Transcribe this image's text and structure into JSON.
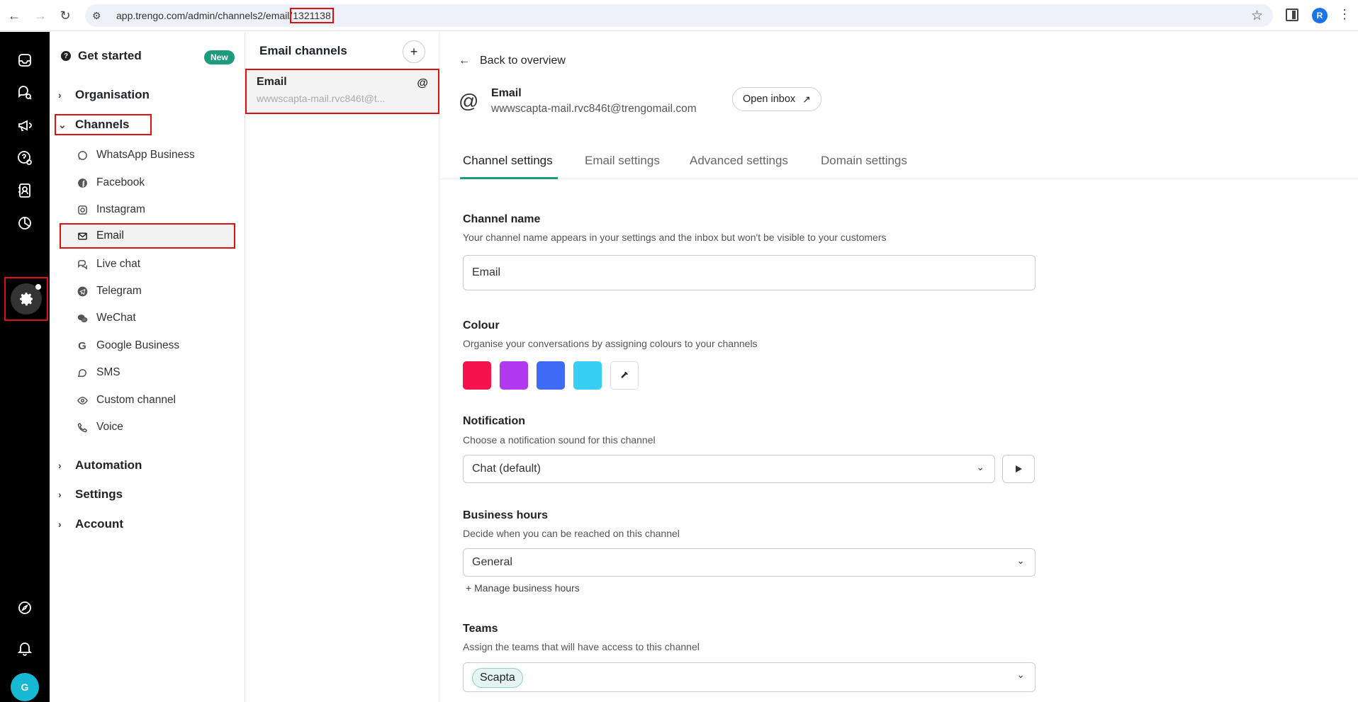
{
  "browser": {
    "url_prefix": "app.trengo.com/admin/channels2/email/",
    "url_id": "1321138",
    "profile_initial": "R"
  },
  "rail": {
    "avatar_initial": "G"
  },
  "nav": {
    "get_started": "Get started",
    "new_badge": "New",
    "sections": {
      "organisation": "Organisation",
      "channels": "Channels",
      "automation": "Automation",
      "settings": "Settings",
      "account": "Account"
    },
    "channels": [
      {
        "label": "WhatsApp Business",
        "icon": "whatsapp-icon"
      },
      {
        "label": "Facebook",
        "icon": "facebook-icon"
      },
      {
        "label": "Instagram",
        "icon": "instagram-icon"
      },
      {
        "label": "Email",
        "icon": "mail-icon"
      },
      {
        "label": "Live chat",
        "icon": "chat-icon"
      },
      {
        "label": "Telegram",
        "icon": "telegram-icon"
      },
      {
        "label": "WeChat",
        "icon": "wechat-icon"
      },
      {
        "label": "Google Business",
        "icon": "google-icon"
      },
      {
        "label": "SMS",
        "icon": "sms-icon"
      },
      {
        "label": "Custom channel",
        "icon": "eye-icon"
      },
      {
        "label": "Voice",
        "icon": "phone-icon"
      }
    ]
  },
  "channel_list": {
    "title": "Email channels",
    "add_label": "+",
    "card": {
      "title": "Email",
      "subtitle": "wwwscapta-mail.rvc846t@t...",
      "icon_glyph": "@"
    }
  },
  "main": {
    "back_label": "Back to overview",
    "channel": {
      "name": "Email",
      "address": "wwwscapta-mail.rvc846t@trengomail.com",
      "glyph": "@"
    },
    "open_inbox": "Open inbox",
    "tabs": [
      "Channel settings",
      "Email settings",
      "Advanced settings",
      "Domain settings"
    ],
    "channel_name": {
      "title": "Channel name",
      "desc": "Your channel name appears in your settings and the inbox but won't be visible to your customers",
      "value": "Email"
    },
    "colour": {
      "title": "Colour",
      "desc": "Organise your conversations by assigning colours to your channels",
      "swatches": [
        "#f5134f",
        "#b13af0",
        "#3d6bf6",
        "#39cff4"
      ]
    },
    "notification": {
      "title": "Notification",
      "desc": "Choose a notification sound for this channel",
      "value": "Chat (default)"
    },
    "business_hours": {
      "title": "Business hours",
      "desc": "Decide when you can be reached on this channel",
      "value": "General",
      "manage": "+ Manage business hours"
    },
    "teams": {
      "title": "Teams",
      "desc": "Assign the teams that will have access to this channel",
      "chip": "Scapta"
    }
  },
  "colors": {
    "accent": "#1c9c7c",
    "highlight": "#d11111"
  }
}
